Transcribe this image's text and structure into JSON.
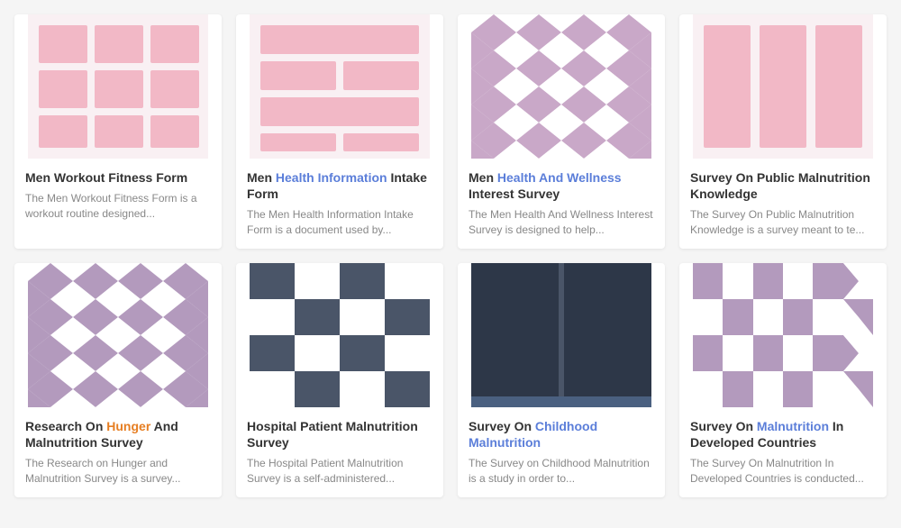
{
  "cards": [
    {
      "id": "men-workout",
      "title": "Men Workout Fitness Form",
      "title_plain": "Men Workout Fitness Form",
      "description": "The Men Workout Fitness Form is a workout routine designed...",
      "thumbnail_type": "pink-grid",
      "highlight": null
    },
    {
      "id": "men-health-info",
      "title_parts": [
        {
          "text": "Men ",
          "style": "normal"
        },
        {
          "text": "Health Information",
          "style": "blue"
        },
        {
          "text": " Intake Form",
          "style": "normal"
        }
      ],
      "title_plain": "Men Health Information Intake Form",
      "description": "The Men Health Information Intake Form is a document used by...",
      "thumbnail_type": "pink-stripes",
      "highlight": "blue"
    },
    {
      "id": "men-health-wellness",
      "title_parts": [
        {
          "text": "Men ",
          "style": "normal"
        },
        {
          "text": "Health And Wellness",
          "style": "blue"
        },
        {
          "text": " Interest Survey",
          "style": "normal"
        }
      ],
      "title_plain": "Men Health And Wellness Interest Survey",
      "description": "The Men Health And Wellness Interest Survey is designed to help...",
      "thumbnail_type": "diamond-pink",
      "highlight": "blue"
    },
    {
      "id": "public-malnutrition",
      "title": "Survey On Public Malnutrition Knowledge",
      "title_plain": "Survey On Public Malnutrition Knowledge",
      "description": "The Survey On Public Malnutrition Knowledge is a survey meant to te...",
      "thumbnail_type": "pink-cols",
      "highlight": null
    },
    {
      "id": "hunger-malnutrition",
      "title_parts": [
        {
          "text": "Research On ",
          "style": "normal"
        },
        {
          "text": "Hunger",
          "style": "orange"
        },
        {
          "text": " And Malnutrition Survey",
          "style": "normal"
        }
      ],
      "title_plain": "Research On Hunger And Malnutrition Survey",
      "description": "The Research on Hunger and Malnutrition Survey is a survey...",
      "thumbnail_type": "diamond-mauve",
      "highlight": "orange"
    },
    {
      "id": "hospital-patient",
      "title_parts": [
        {
          "text": "Hospital Patient Malnutrition Survey",
          "style": "normal"
        }
      ],
      "title_plain": "Hospital Patient Malnutrition Survey",
      "description": "The Hospital Patient Malnutrition Survey is a self-administered...",
      "thumbnail_type": "checker-dark",
      "highlight": null
    },
    {
      "id": "childhood-malnutrition",
      "title_parts": [
        {
          "text": "Survey On ",
          "style": "normal"
        },
        {
          "text": "Childhood Malnutrition",
          "style": "blue"
        },
        {
          "text": "",
          "style": "normal"
        }
      ],
      "title_plain": "Survey On Childhood Malnutrition",
      "description": "The Survey on Childhood Malnutrition is a study in order to...",
      "thumbnail_type": "solid-dark",
      "highlight": "blue"
    },
    {
      "id": "malnutrition-developed",
      "title_parts": [
        {
          "text": "Survey On ",
          "style": "normal"
        },
        {
          "text": "Malnutrition",
          "style": "blue"
        },
        {
          "text": " In Developed Countries",
          "style": "normal"
        }
      ],
      "title_plain": "Survey On Malnutrition In Developed Countries",
      "description": "The Survey On Malnutrition In Developed Countries is conducted...",
      "thumbnail_type": "chevron",
      "highlight": "blue"
    }
  ],
  "colors": {
    "blue": "#5b7ed9",
    "orange": "#e67e22",
    "pink_bg": "#f9f0f3",
    "pink_cell": "#f2b8c6",
    "mauve": "#b39abd",
    "dark": "#4a5568",
    "white": "#ffffff"
  }
}
